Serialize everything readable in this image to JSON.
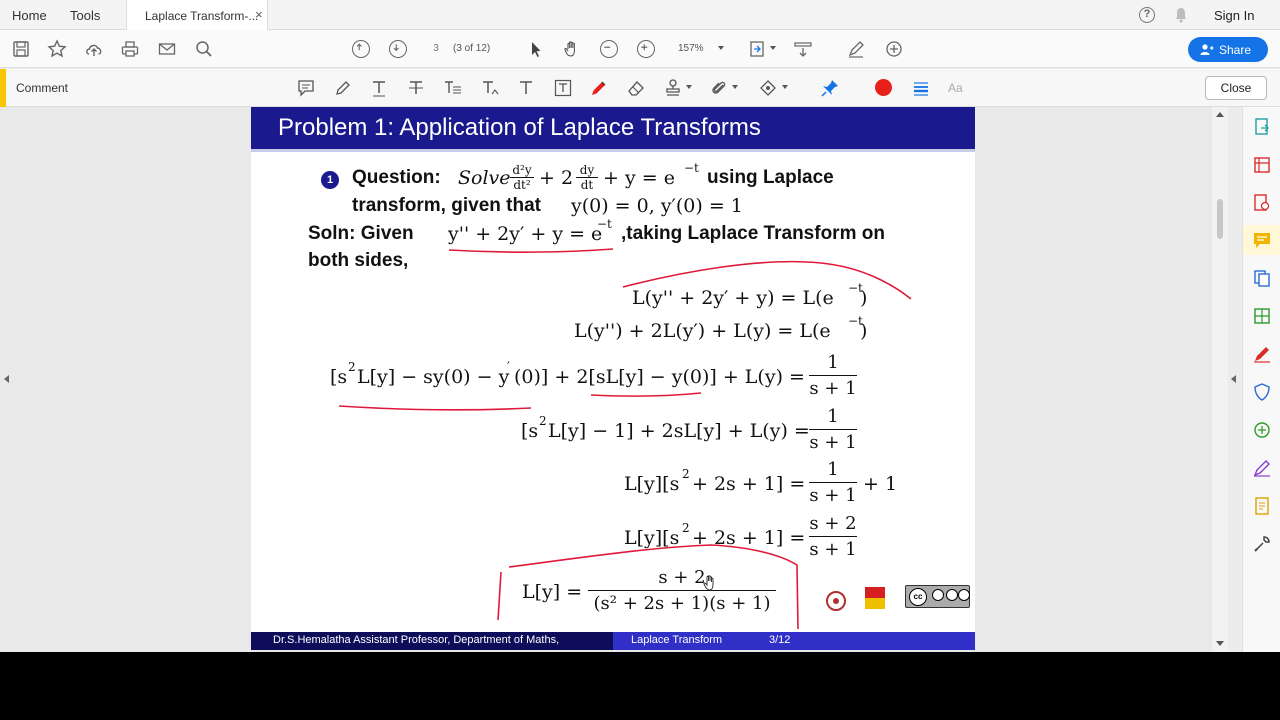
{
  "menubar": {
    "home": "Home",
    "tools": "Tools",
    "tab_title": "Laplace Transform-...",
    "tab_close": "×",
    "help": "?",
    "sign_in": "Sign In"
  },
  "toolbar": {
    "page_current": "3",
    "page_of": "(3 of 12)",
    "zoom": "157%",
    "share": "Share"
  },
  "commentbar": {
    "label": "Comment",
    "text_size_label": "Aa",
    "close": "Close"
  },
  "slide": {
    "title": "Problem 1: Application of Laplace Transforms",
    "bullet": "1",
    "question_label": "Question:",
    "question_solve": "Solve",
    "question_using": "using Laplace",
    "question_line2": "transform, given that",
    "question_init": "y(0) = 0, y′(0) = 1",
    "soln_label": "Soln: Given",
    "soln_eq": "y'' + 2y′ + y = e",
    "soln_exp": "−t",
    "soln_taking": ",taking Laplace Transform on",
    "soln_line2": "both sides,",
    "ode_lhs": "+ 2",
    "ode_mid": "+ y = e",
    "ode_exp": "−t",
    "eq1": "L(y'' + 2y′ + y) = L(e",
    "eq1_exp": "−t",
    "eq2": "L(y'') + 2L(y′) + L(y) = L(e",
    "eq2_exp": "−t",
    "eq3_lhs_a": "[s",
    "eq3_lhs_b": "L[y] − sy(0) − y",
    "eq3_lhs_c": "(0)] + 2[sL[y] − y(0)] + L(y) =",
    "eq4_lhs_a": "[s",
    "eq4_lhs_b": "L[y] − 1] + 2sL[y] + L(y) =",
    "eq5_lhs_a": "L[y][s",
    "eq5_lhs_b": "+ 2s + 1] =",
    "eq5_tail": "+ 1",
    "eq6_lhs_a": "L[y][s",
    "eq6_lhs_b": "+ 2s + 1] =",
    "eq7_lhs": "L[y] =",
    "frac_one": "1",
    "frac_sp1": "s + 1",
    "frac_sp2": "s + 2",
    "frac_final_den": "(s² + 2s + 1)(s + 1)",
    "sup_two": "2",
    "prime": "′",
    "d2y": "d²y",
    "dt2": "dt²",
    "dy": "dy",
    "dt": "dt",
    "close_paren": ")"
  },
  "footer": {
    "author": "Dr.S.Hemalatha  Assistant Professor,  Department of Maths,",
    "topic": "Laplace Transform",
    "page": "3/12"
  },
  "colors": {
    "title_bar": "#1a1a8e",
    "share_button": "#1473e6",
    "comment_accent": "#f9c500",
    "ink_red": "#e0193a"
  }
}
